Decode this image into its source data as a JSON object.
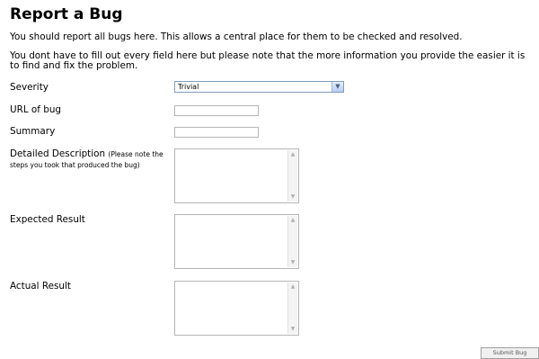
{
  "page": {
    "title": "Report a Bug",
    "intro": "You should report all bugs here. This allows a central place for them to be checked and resolved.",
    "note": "You dont have to fill out every field here but please note that the more information you provide the easier it is to find and fix the problem."
  },
  "form": {
    "severity": {
      "label": "Severity",
      "value": "Trivial"
    },
    "url": {
      "label": "URL of bug",
      "value": ""
    },
    "summary": {
      "label": "Summary",
      "value": ""
    },
    "description": {
      "label": "Detailed Description",
      "hint": "(Please note the steps you took that produced the bug)",
      "value": ""
    },
    "expected": {
      "label": "Expected Result",
      "value": ""
    },
    "actual": {
      "label": "Actual Result",
      "value": ""
    },
    "submit_label": "Submit Bug"
  }
}
